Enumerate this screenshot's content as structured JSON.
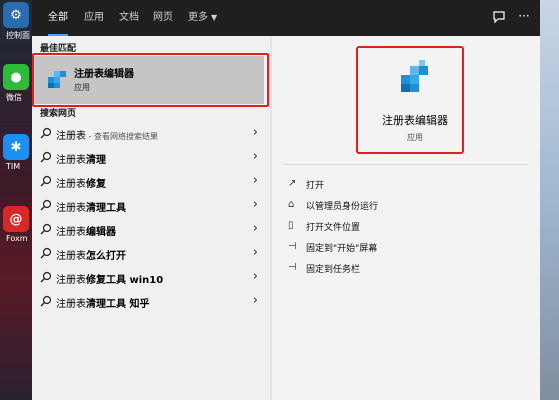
{
  "desktop": {
    "icons": [
      {
        "label": "控制面",
        "name": "control-panel-icon"
      },
      {
        "label": "微信",
        "name": "wechat-icon"
      },
      {
        "label": "TIM",
        "name": "tim-icon"
      },
      {
        "label": "Foxm",
        "name": "foxmail-icon"
      }
    ]
  },
  "tabs": [
    {
      "label": "全部",
      "active": true
    },
    {
      "label": "应用"
    },
    {
      "label": "文档"
    },
    {
      "label": "网页"
    },
    {
      "label": "更多"
    }
  ],
  "best_match": {
    "section": "最佳匹配",
    "title": "注册表编辑器",
    "subtitle": "应用"
  },
  "web": {
    "section": "搜索网页",
    "rows": [
      {
        "base": "注册表",
        "bold": "",
        "hint": " - 查看网络搜索结果"
      },
      {
        "base": "注册表",
        "bold": "清理",
        "hint": ""
      },
      {
        "base": "注册表",
        "bold": "修复",
        "hint": ""
      },
      {
        "base": "注册表",
        "bold": "清理工具",
        "hint": ""
      },
      {
        "base": "注册表",
        "bold": "编辑器",
        "hint": ""
      },
      {
        "base": "注册表",
        "bold": "怎么打开",
        "hint": ""
      },
      {
        "base": "注册表",
        "bold": "修复工具 win10",
        "hint": ""
      },
      {
        "base": "注册表",
        "bold": "清理工具 知乎",
        "hint": ""
      }
    ]
  },
  "detail": {
    "title": "注册表编辑器",
    "subtitle": "应用",
    "actions": [
      {
        "label": "打开",
        "icon": "open-icon"
      },
      {
        "label": "以管理员身份运行",
        "icon": "admin-shield-icon"
      },
      {
        "label": "打开文件位置",
        "icon": "file-location-icon"
      },
      {
        "label": "固定到\"开始\"屏幕",
        "icon": "pin-start-icon"
      },
      {
        "label": "固定到任务栏",
        "icon": "pin-taskbar-icon"
      }
    ]
  },
  "colors": {
    "topbar": "#1f1f1f",
    "accent": "#4aa0ff",
    "highlight": "#e02020"
  }
}
